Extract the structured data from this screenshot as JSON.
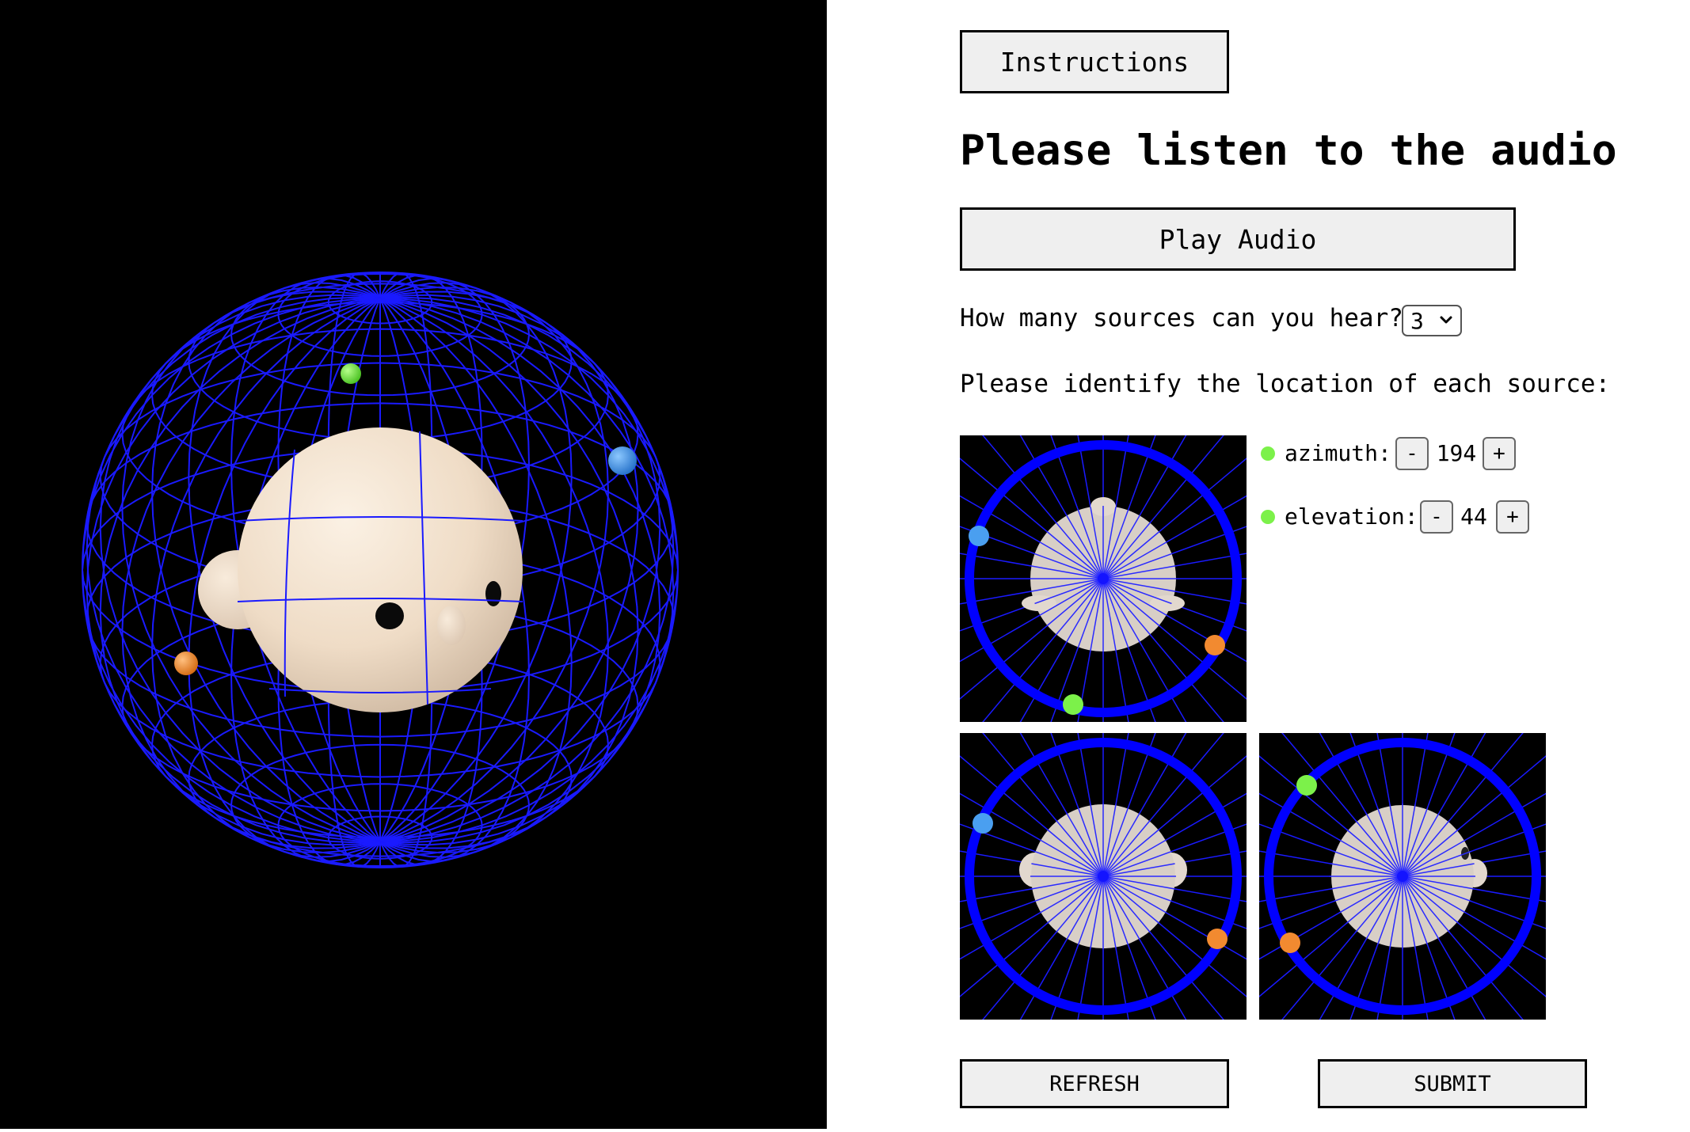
{
  "panel": {
    "instructions_label": "Instructions",
    "heading": "Please listen to the audio",
    "play_label": "Play Audio",
    "sources_question": "How many sources can you hear?",
    "sources_selected": "3",
    "identify_prompt": "Please identify the location of each source:",
    "refresh_label": "REFRESH",
    "submit_label": "SUBMIT"
  },
  "active_source": {
    "color": "#7cf14a",
    "azimuth_label": "azimuth:",
    "azimuth_value": "194",
    "elevation_label": "elevation:",
    "elevation_value": "44",
    "decrement_label": "-",
    "increment_label": "+"
  },
  "source_colors": {
    "green": "#7cf14a",
    "blue": "#4a9ff0",
    "orange": "#f28a30"
  },
  "colors": {
    "wireframe": "#1a1aff",
    "head": "#f3e4d2",
    "view_ring": "#0000ff"
  }
}
